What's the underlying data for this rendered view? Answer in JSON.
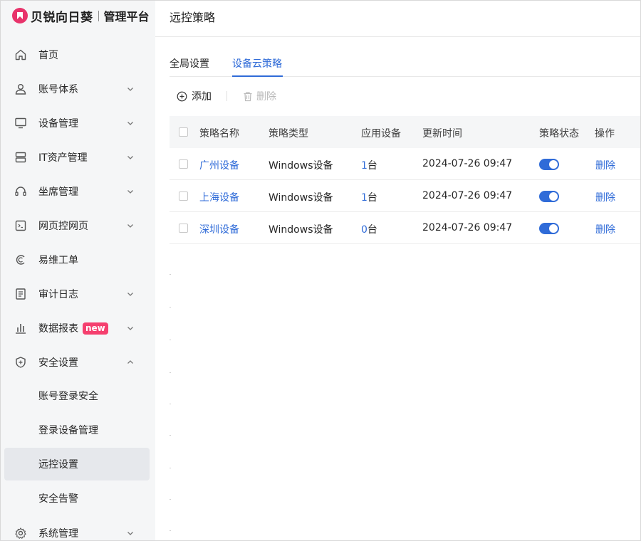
{
  "brand": {
    "name": "贝锐向日葵",
    "product": "管理平台"
  },
  "sidebar": {
    "items": [
      {
        "label": "首页",
        "icon": "home-icon",
        "has_chevron": false,
        "chevron": "none"
      },
      {
        "label": "账号体系",
        "icon": "user-icon",
        "has_chevron": true,
        "chevron": "down"
      },
      {
        "label": "设备管理",
        "icon": "monitor-icon",
        "has_chevron": true,
        "chevron": "down"
      },
      {
        "label": "IT资产管理",
        "icon": "server-icon",
        "has_chevron": true,
        "chevron": "down"
      },
      {
        "label": "坐席管理",
        "icon": "headset-icon",
        "has_chevron": true,
        "chevron": "down"
      },
      {
        "label": "网页控网页",
        "icon": "web-control-icon",
        "has_chevron": true,
        "chevron": "down"
      },
      {
        "label": "易维工单",
        "icon": "ticket-icon",
        "has_chevron": false,
        "chevron": "none"
      },
      {
        "label": "审计日志",
        "icon": "document-icon",
        "has_chevron": true,
        "chevron": "down"
      },
      {
        "label": "数据报表",
        "icon": "bar-chart-icon",
        "has_chevron": true,
        "chevron": "down",
        "badge": "new"
      },
      {
        "label": "安全设置",
        "icon": "shield-icon",
        "has_chevron": true,
        "chevron": "up"
      }
    ],
    "sub_items": [
      {
        "label": "账号登录安全",
        "active": false
      },
      {
        "label": "登录设备管理",
        "active": false
      },
      {
        "label": "远控设置",
        "active": true
      },
      {
        "label": "安全告警",
        "active": false
      }
    ],
    "last_item": {
      "label": "系统管理",
      "icon": "gear-icon",
      "chevron": "down"
    }
  },
  "header": {
    "title": "远控策略"
  },
  "tabs": [
    {
      "label": "全局设置",
      "active": false
    },
    {
      "label": "设备云策略",
      "active": true
    }
  ],
  "toolbar": {
    "add_label": "添加",
    "delete_label": "删除",
    "delete_disabled": true
  },
  "table": {
    "columns": [
      "策略名称",
      "策略类型",
      "应用设备",
      "更新时间",
      "策略状态",
      "操作"
    ],
    "rows": [
      {
        "name": "广州设备",
        "type": "Windows设备",
        "device_count": "1",
        "device_unit": "台",
        "updated": "2024-07-26 09:47",
        "enabled": true,
        "action": "删除"
      },
      {
        "name": "上海设备",
        "type": "Windows设备",
        "device_count": "1",
        "device_unit": "台",
        "updated": "2024-07-26 09:47",
        "enabled": true,
        "action": "删除"
      },
      {
        "name": "深圳设备",
        "type": "Windows设备",
        "device_count": "0",
        "device_unit": "台",
        "updated": "2024-07-26 09:47",
        "enabled": true,
        "action": "删除"
      }
    ]
  },
  "colors": {
    "accent": "#2f6bd8",
    "brand": "#e8336b",
    "badge": "#f53f6e",
    "sidebar_bg": "#f5f6f7",
    "active_item_bg": "#e6e8ec"
  }
}
